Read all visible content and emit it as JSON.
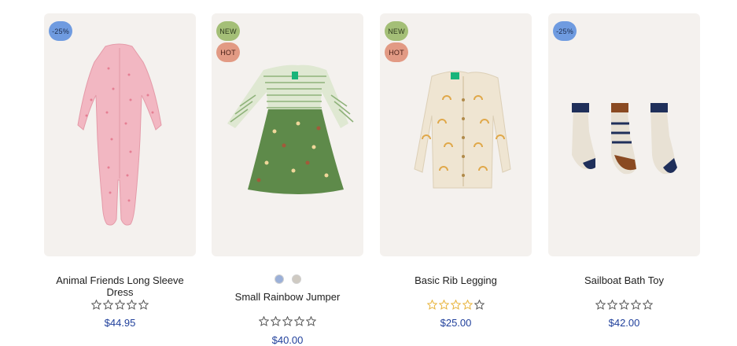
{
  "products": [
    {
      "title": "Animal Friends Long Sleeve Dress",
      "price": "$44.95",
      "rating": 0,
      "badges": [
        "-25%"
      ]
    },
    {
      "title": "Small Rainbow Jumper",
      "price": "$40.00",
      "rating": 0,
      "badges": [
        "NEW",
        "HOT"
      ],
      "swatches": [
        "#9bb0d8",
        "#cfcac2"
      ]
    },
    {
      "title": "Basic Rib Legging",
      "price": "$25.00",
      "rating": 4,
      "badges": [
        "NEW",
        "HOT"
      ]
    },
    {
      "title": "Sailboat Bath Toy",
      "price": "$42.00",
      "rating": 0,
      "badges": [
        "-25%"
      ]
    }
  ],
  "colors": {
    "card_bg": "#f4f1ee",
    "price": "#1f3f9b",
    "sale_badge": "#6f9be0",
    "new_badge": "#a4bf77",
    "hot_badge": "#e29a84",
    "star_filled": "#e8b33a",
    "star_empty": "#555555"
  }
}
